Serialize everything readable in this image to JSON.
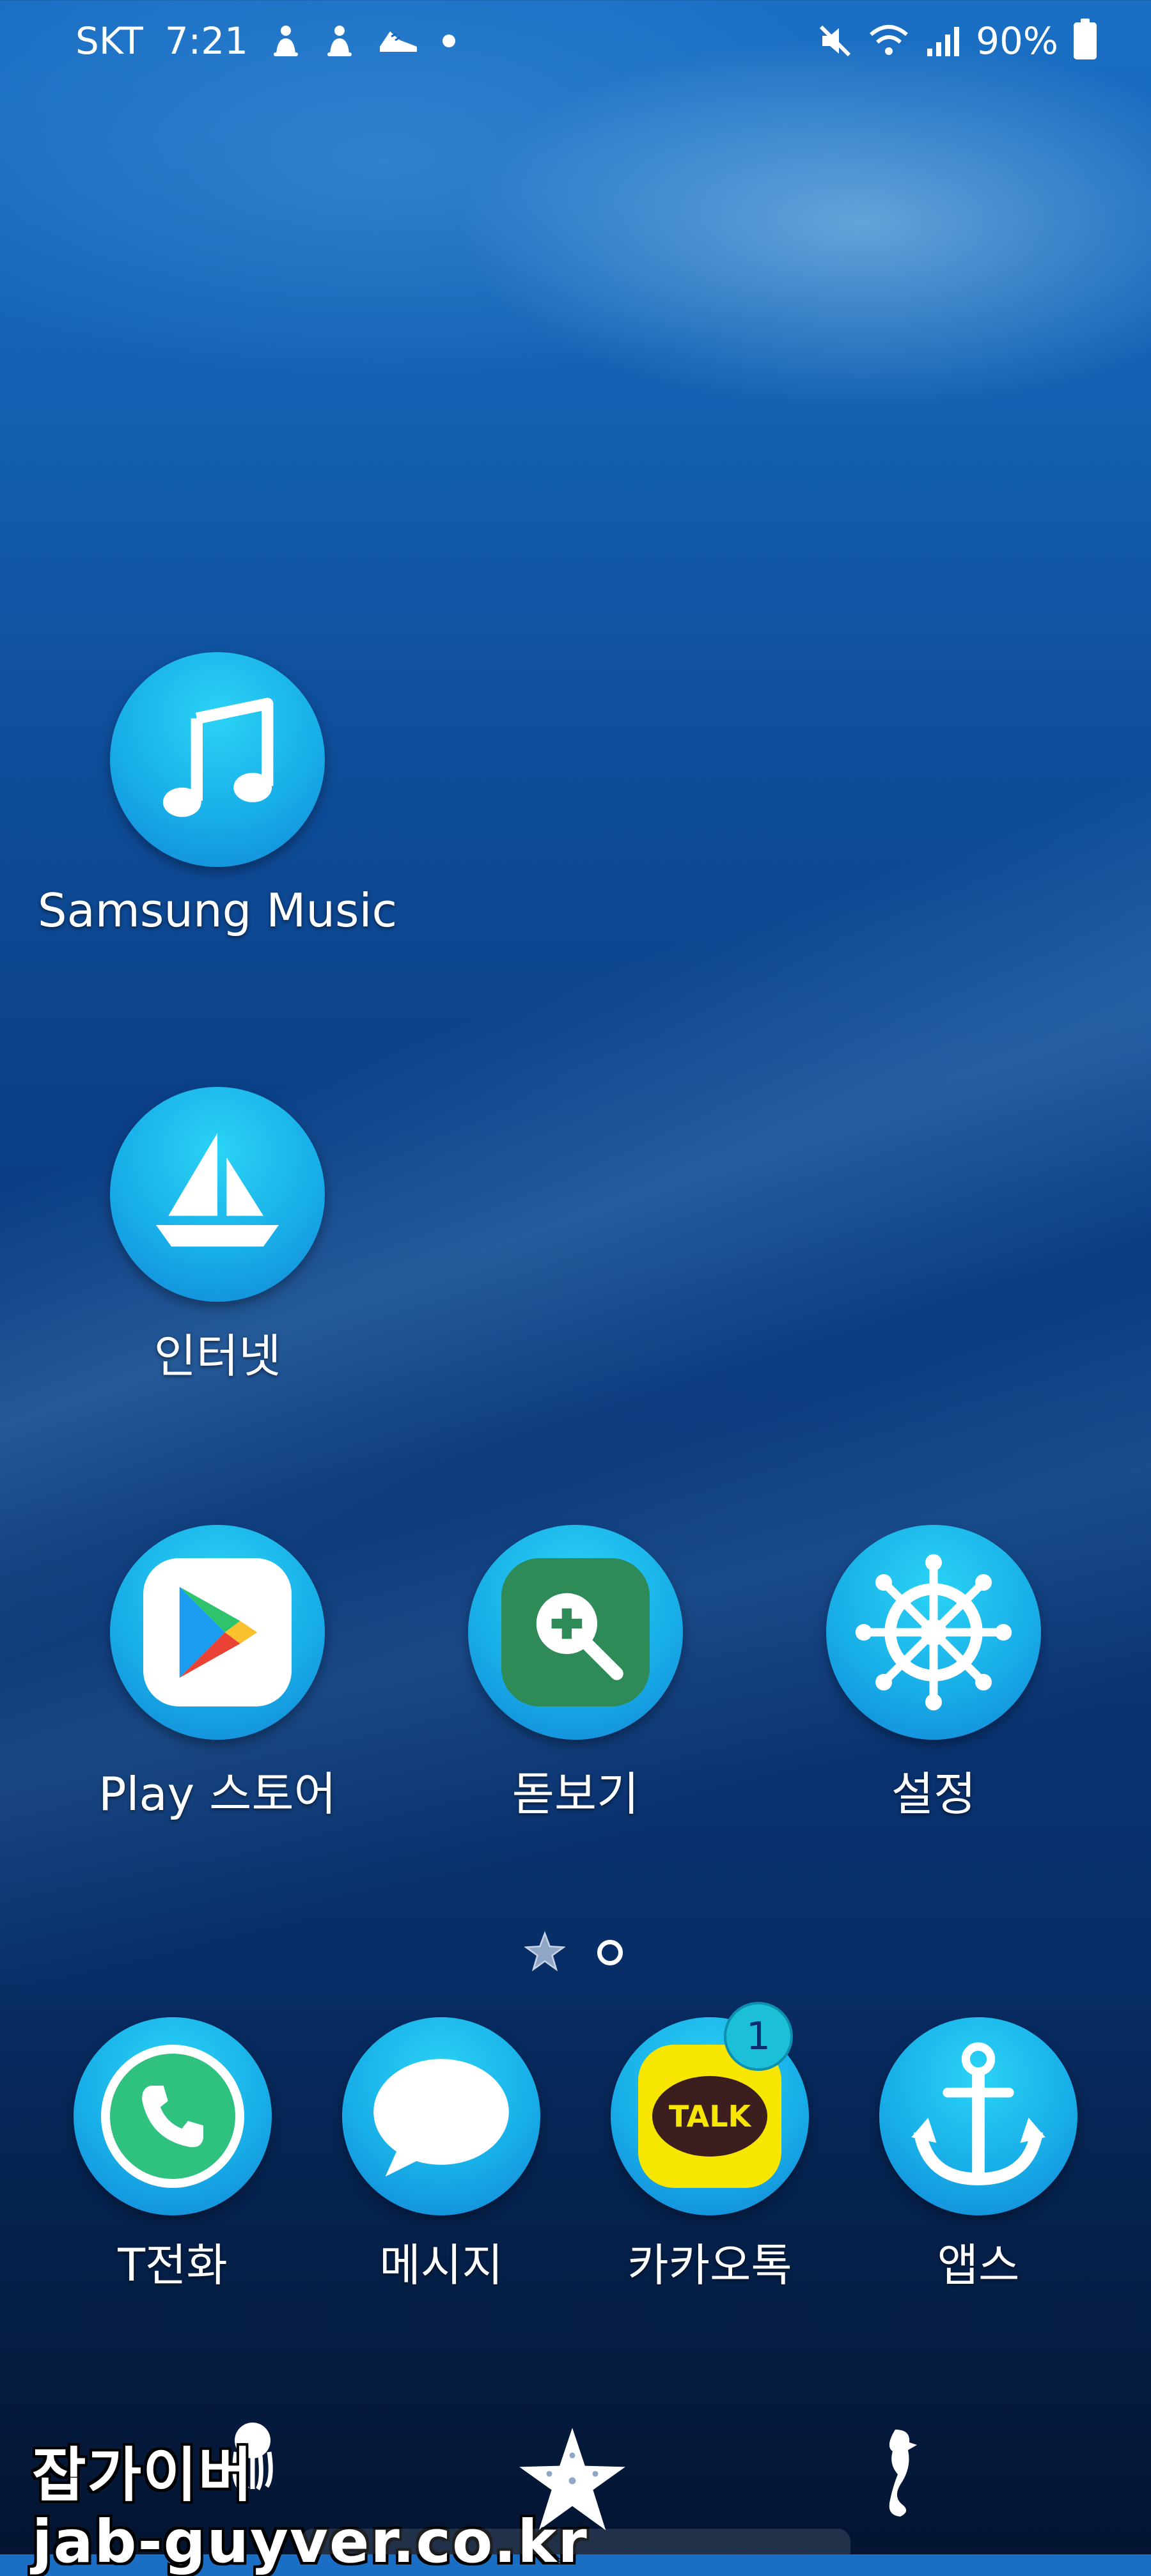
{
  "status_bar": {
    "carrier": "SKT",
    "time": "7:21",
    "battery": "90%",
    "left_icons": [
      "alert-icon",
      "alert-icon",
      "shoe-icon",
      "dot-icon"
    ],
    "right_icons": [
      "mute-icon",
      "wifi-icon",
      "signal-icon",
      "battery-icon"
    ]
  },
  "home": {
    "apps": [
      {
        "label": "Samsung Music",
        "icon": "music-note-icon"
      },
      {
        "label": "인터넷",
        "icon": "sailboat-icon"
      },
      {
        "label": "Play 스토어",
        "icon": "play-store-icon"
      },
      {
        "label": "돋보기",
        "icon": "magnifier-icon"
      },
      {
        "label": "설정",
        "icon": "ship-wheel-icon"
      }
    ]
  },
  "pager": {
    "pages": 2,
    "current": 1
  },
  "dock": {
    "apps": [
      {
        "label": "T전화",
        "icon": "phone-icon"
      },
      {
        "label": "메시지",
        "icon": "message-icon"
      },
      {
        "label": "카카오톡",
        "icon": "kakaotalk-icon",
        "badge": "1",
        "icon_text": "TALK"
      },
      {
        "label": "앱스",
        "icon": "anchor-icon"
      }
    ]
  },
  "watermark": {
    "line1": "잡가이버",
    "line2": "jab-guyver.co.kr"
  },
  "colors": {
    "icon_bg": "#18aee8",
    "badge": "#1bc0d8",
    "kakao_yellow": "#f7e600"
  }
}
